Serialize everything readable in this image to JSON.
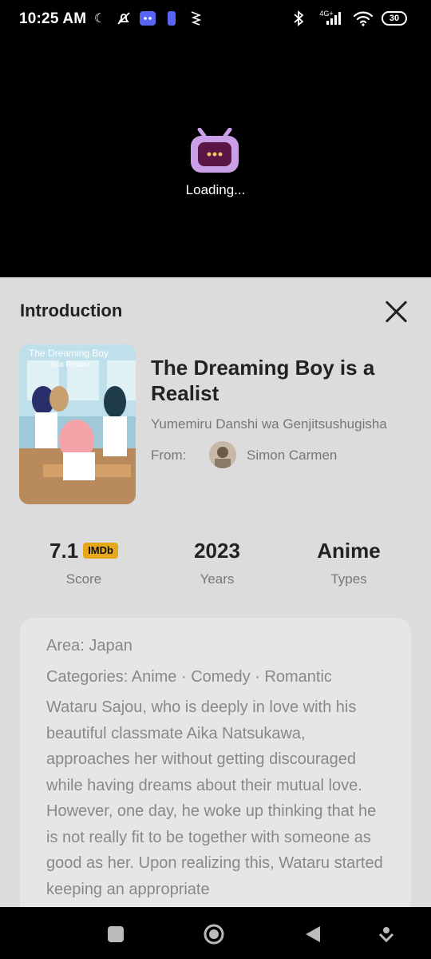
{
  "status_bar": {
    "time": "10:25 AM",
    "network": "4G+",
    "battery": "30"
  },
  "player": {
    "loading_text": "Loading..."
  },
  "sheet": {
    "title": "Introduction",
    "show": {
      "title": "The Dreaming Boy is a Realist",
      "alt_title": "Yumemiru Danshi wa Genjitsushugisha",
      "from_label": "From:",
      "uploader": "Simon Carmen",
      "poster_text_line1": "The Dreaming Boy",
      "poster_text_line2": "is a Realist"
    },
    "stats": [
      {
        "value": "7.1",
        "badge": "IMDb",
        "label": "Score"
      },
      {
        "value": "2023",
        "label": "Years"
      },
      {
        "value": "Anime",
        "label": "Types"
      }
    ],
    "info": {
      "area": "Area: Japan",
      "categories": "Categories: Anime · Comedy · Romantic",
      "description": "Wataru Sajou, who is deeply in love with his beautiful classmate Aika Natsukawa, approaches her without getting discouraged while having dreams about their mutual love. However, one day, he woke up thinking that he is not really fit to be together with someone as good as her. Upon realizing this, Wataru started keeping an appropriate"
    }
  }
}
